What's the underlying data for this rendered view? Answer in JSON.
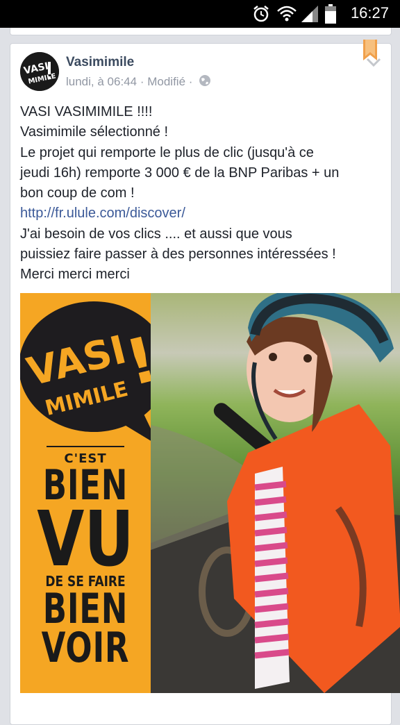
{
  "status_bar": {
    "time": "16:27",
    "icons": [
      "alarm-icon",
      "wifi-icon",
      "signal-icon",
      "battery-icon"
    ]
  },
  "post": {
    "author": "Vasimimile",
    "timestamp": "lundi, à 06:44",
    "edited": "Modifié",
    "separator": "·",
    "lines": [
      "VASI VASIMIMILE !!!!",
      "Vasimimile sélectionné !",
      "Le projet qui remporte le plus de clic (jusqu'à ce",
      "jeudi 16h) remporte 3 000 € de la BNP Paribas + un",
      "bon coup de com !",
      "http://fr.ulule.com/discover/",
      "J'ai besoin de vos clics .... et aussi que vous",
      "puissiez faire passer à des personnes intéressées !",
      "Merci merci merci"
    ]
  },
  "image": {
    "logo_line1": "VASI",
    "logo_line2": "MIMILE",
    "logo_exclaim": "!",
    "avatar_line1": "VASI",
    "avatar_line2": "MIMILE",
    "slogan_1": "C'EST",
    "slogan_2": "BIEN",
    "slogan_3": "VU",
    "slogan_4": "DE SE FAIRE",
    "slogan_5": "BIEN",
    "slogan_6": "VOIR"
  },
  "colors": {
    "brand_orange": "#f5a623",
    "link": "#3b5998",
    "author": "#3b4a5f"
  }
}
